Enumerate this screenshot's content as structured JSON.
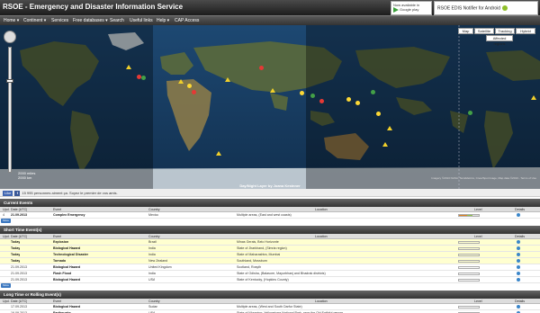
{
  "header": {
    "title": "RSOE - Emergency and Disaster Information Service",
    "play_badge": {
      "top_text": "Now available in",
      "store_text": "Google play"
    },
    "notifier_badge": "RSOE EDIS Notifier for Android"
  },
  "nav": [
    {
      "label": "Home ▾"
    },
    {
      "label": "Continent ▾"
    },
    {
      "label": "Services"
    },
    {
      "label": "Free databases ▾"
    },
    {
      "label": "Search"
    },
    {
      "label": "Useful links"
    },
    {
      "label": "Help ▾"
    },
    {
      "label": "CAP Access"
    }
  ],
  "map": {
    "type_buttons": [
      "Map",
      "Satellite",
      "Tracking",
      "Hybrid"
    ],
    "overlay_toggle": "Affected regions",
    "scale": [
      "2000 miles",
      "2000 km"
    ],
    "caption": "Day/Night Layer by Joana Kestnner",
    "credit": "Imagery ©2013 NASA, TerraMetrics, Cnes/Spot Image, Map data ©2013 - Terms of Use"
  },
  "social": {
    "like": "Like",
    "fb": "f",
    "text": "15 995 personnes aiment ça. Soyez le premier de vos amis."
  },
  "columns": [
    "Upd.",
    "Date (UTC)",
    "Event",
    "Country",
    "Location",
    "Level",
    "Details"
  ],
  "sections": [
    {
      "title": "Current Events",
      "more": "More",
      "rows": [
        {
          "upd": "4",
          "date": "21.09.2013",
          "event": "Complex Emergency",
          "country": "Mexico",
          "location": "Multiple areas, (East and west coasts)",
          "level": "high",
          "bold": true,
          "style": "white"
        }
      ]
    },
    {
      "title": "Short Time Event(s)",
      "more": "More",
      "rows": [
        {
          "upd": "",
          "date": "Today",
          "event": "Explosion",
          "country": "Brazil",
          "location": "Minas Gerais, Belo Horizonte",
          "level": "empty",
          "bold": true,
          "style": "yellow"
        },
        {
          "upd": "",
          "date": "Today",
          "event": "Biological Hazard",
          "country": "India",
          "location": "State of Jharkhand, (Simria region)",
          "level": "empty",
          "bold": true,
          "style": "yellow"
        },
        {
          "upd": "",
          "date": "Today",
          "event": "Technological Disaster",
          "country": "India",
          "location": "State of Maharashtra, Mumbai",
          "level": "empty",
          "bold": true,
          "style": "yellow"
        },
        {
          "upd": "",
          "date": "Today",
          "event": "Tornado",
          "country": "New Zealand",
          "location": "Southland, Mossburn",
          "level": "empty",
          "bold": true,
          "style": "yellow"
        },
        {
          "upd": "",
          "date": "21.09.2013",
          "event": "Biological Hazard",
          "country": "United Kingdom",
          "location": "Scotland, Rosyth",
          "level": "empty",
          "bold": false,
          "style": "white"
        },
        {
          "upd": "",
          "date": "21.09.2013",
          "event": "Flash Flood",
          "country": "India",
          "location": "State of Odisha, (Balasore, Mayurbhanj and Bhadrak districts)",
          "level": "empty",
          "bold": false,
          "style": "white"
        },
        {
          "upd": "",
          "date": "21.09.2013",
          "event": "Biological Hazard",
          "country": "USA",
          "location": "State of Kentucky, (Hopkins County)",
          "level": "empty",
          "bold": false,
          "style": "white"
        }
      ]
    },
    {
      "title": "Long Time or Rolling Event(s)",
      "more": "",
      "rows": [
        {
          "upd": "",
          "date": "17.09.2013",
          "event": "Biological Hazard",
          "country": "Sudan",
          "location": "Multiple areas, (West and South Darfur State)",
          "level": "empty",
          "bold": false,
          "style": "white"
        },
        {
          "upd": "",
          "date": "16.09.2013",
          "event": "Earthquake",
          "country": "USA",
          "location": "State of Wyoming, Yellowstone National Park, near the Old Faithful geyser",
          "level": "empty",
          "bold": false,
          "style": "white"
        }
      ]
    }
  ],
  "colors": {
    "accent": "#3c78c0",
    "level_high": "#e08020",
    "level_low": "#8bc34a"
  }
}
